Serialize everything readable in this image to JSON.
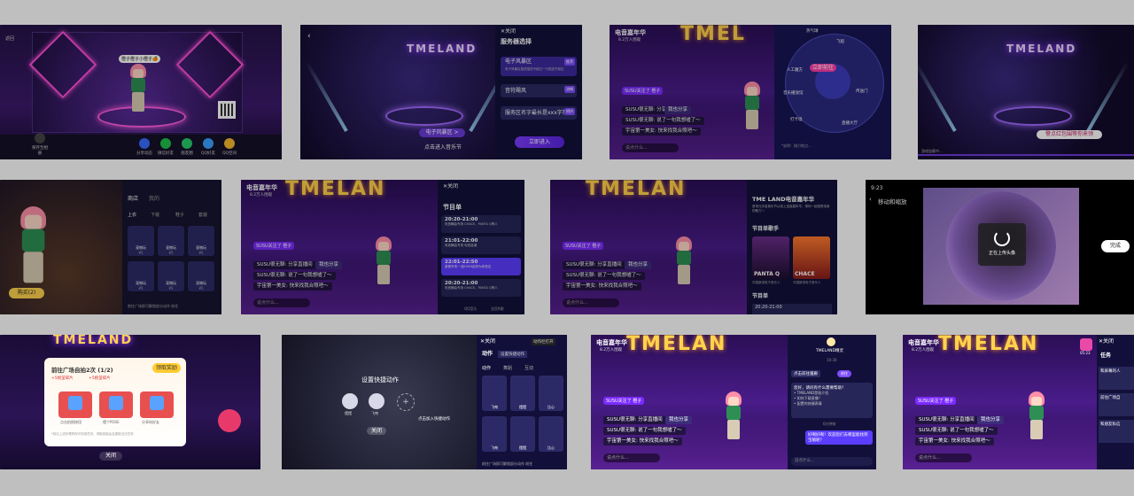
{
  "screen1": {
    "back": "返回",
    "nameplate": "橙子橙子小橙子🍊",
    "save": "保存至相册",
    "share": [
      "分享动态",
      "微信好友",
      "朋友圈",
      "QQ好友",
      "QQ空间"
    ],
    "share_colors": [
      "#3a6bff",
      "#1fbf4c",
      "#2ac96b",
      "#3aa0ff",
      "#f5b82e"
    ]
  },
  "screen2": {
    "logo": "TMELAND",
    "banner": "电子风暴区 >",
    "enter_text": "点击进入音乐节",
    "close": "✕关闭",
    "title": "服务器选择",
    "options": [
      {
        "name": "电子风暴区",
        "sub": "电子风暴区描述描述不超过一行描述不超过",
        "tag": "推荐"
      },
      {
        "name": "音符飓风",
        "sub": "",
        "tag": "流畅"
      },
      {
        "name": "服务区名字最长是xxx字符",
        "sub": "",
        "tag": "拥挤"
      }
    ],
    "enter_btn": "立即进入"
  },
  "screen3": {
    "event": "电音嘉年华",
    "viewers": "8.2万人围观",
    "mention": "SUSU关注了 橙子",
    "chat": [
      "SUSU很无聊: 分享直播间",
      "SUSU很无聊: 说了一句我想嘘了～",
      "宇宙第一美女: 快来找我合照吧～"
    ],
    "share_chip": "我也分享",
    "input": "说点什么...",
    "wheel_items": [
      "热气球",
      "飞船",
      "人工魔方",
      "立即前往",
      "音乐播放馆",
      "传送门",
      "游乐场",
      "直播大厅",
      "打卡墙",
      "现在..."
    ],
    "wheel_center": "立即前往",
    "footnote": "*说明：指引地点..."
  },
  "screen4": {
    "logo": "TMELAND",
    "hint": "警点红包围等你来领",
    "bottom": "游戏加载中..."
  },
  "screen5": {
    "tabs": [
      "商店",
      "我的"
    ],
    "cats": [
      "上衣",
      "下装",
      "鞋子",
      "套装"
    ],
    "items": [
      {
        "name": "宠物玩",
        "price": "¥5"
      },
      {
        "name": "宠物玩",
        "price": "¥5"
      },
      {
        "name": "宠物玩",
        "price": "¥5"
      },
      {
        "name": "宠物玩",
        "price": "¥5"
      },
      {
        "name": "宠物玩",
        "price": "¥5"
      },
      {
        "name": "宠物玩",
        "price": "¥5"
      }
    ],
    "buy": "购买(2)",
    "footer": "前往广场即可解锁部分动作  前往"
  },
  "screen6": {
    "event": "电音嘉年华",
    "viewers": "8.2万人围观",
    "close": "✕关闭",
    "title": "节目单",
    "items": [
      {
        "time": "20:20-21:00",
        "desc": "电音舞曲专场 CHACE、PANTA Q等人"
      },
      {
        "time": "21:01-22:00",
        "desc": "电音舞曲专场 电音高潮"
      },
      {
        "time": "22:01-22:50",
        "desc": "激情专场·一起HIGH起来为你放这"
      },
      {
        "time": "20:20-21:00",
        "desc": "电音舞曲专场 CHACE、PANTA Q等人"
      }
    ],
    "footer": [
      "QQ音乐",
      "全民K歌"
    ],
    "mention": "SUSU关注了 橙子",
    "chat": [
      "SUSU很无聊: 分享直播间",
      "SUSU很无聊: 说了一句我想嘘了～",
      "宇宙第一美女: 快来找我合照吧～"
    ],
    "share_chip": "我也分享",
    "input": "说点什么..."
  },
  "screen7": {
    "title": "TME LAND电音嘉年华",
    "desc": "首场元宇宙音乐节从线上连接嘉年华，带你一起感受电音的魅力～",
    "lineup": "节目单歌手",
    "artists": [
      "PANTA Q",
      "CHACE"
    ],
    "artist_notes": [
      "中国新锐电子音乐人",
      "中国新锐电子音乐人"
    ],
    "schedule_title": "节目单",
    "schedule_time": "20:20-21:00",
    "mention": "SUSU关注了 橙子",
    "chat": [
      "SUSU很无聊: 分享直播间",
      "SUSU很无聊: 说了一句我想嘘了～",
      "宇宙第一美女: 快来找我合照吧～"
    ],
    "share_chip": "我也分享",
    "input": "说点什么..."
  },
  "screen8": {
    "time": "9:23",
    "title": "移动和缩放",
    "loading": "正在上传头像",
    "done": "完成"
  },
  "screen9": {
    "title": "前往广场自拍2次 (1/2)",
    "claim": "领取奖励",
    "rewards": [
      "+5桃萤碎片",
      "+5桃萤碎片"
    ],
    "steps": [
      "点击拍照按钮",
      "摆个POSE",
      "分享给好友"
    ],
    "note": "*前往上述步骤同伴可完成任务，领取奖励后会更新当日任务",
    "close": "关闭"
  },
  "screen10": {
    "title": "设置快捷动作",
    "slots": [
      "摆摆",
      "飞吻"
    ],
    "hint": "点击加入快捷动作",
    "close": "关闭",
    "close2": "✕关闭",
    "toggle": "动作栏打开",
    "tabs": [
      "动作",
      "舞蹈",
      "互动"
    ],
    "set_btn": "设置快捷动作",
    "cells": [
      "飞吻",
      "摆摆",
      "比心",
      "飞吻",
      "摆摆",
      "比心"
    ],
    "footer": "前往广场即可解锁部分动作  前往"
  },
  "screen11": {
    "event": "电音嘉年华",
    "viewers": "8.2万人围观",
    "mention": "SUSU关注了 橙子",
    "chat": [
      "SUSU很无聊: 分享直播间",
      "SUSU很无聊: 说了一句我想嘘了～",
      "宇宙第一美女: 快来找我合照吧～"
    ],
    "share_chip": "我也分享",
    "input": "说点什么...",
    "bot_name": "TMELAND精灵",
    "time": "10:30",
    "go_label": "点击前往遛廊",
    "go_btn": "前往",
    "q": "您好，请问有什么需要帮助？",
    "faq": [
      "• TMELAND是啥介绍",
      "• 如何下载直播？",
      "• 配置的快捷表情"
    ],
    "faq_time": "6分钟前",
    "reply": "好啊好啊！欢迎您们去哪里能找到宝箱呢？",
    "input2": "说点什么..."
  },
  "screen12": {
    "event": "电音嘉年华",
    "viewers": "8.2万人围观",
    "badge": "05:23",
    "mention": "SUSU关注了 橙子",
    "chat": [
      "SUSU很无聊: 分享直播间",
      "SUSU很无聊: 说了一句我想嘘了～",
      "宇宙第一美女: 快来找我合照吧～"
    ],
    "share_chip": "我也分享",
    "input": "说点什么...",
    "close": "✕关闭",
    "task_title": "任务",
    "tasks": [
      "和屏幕的人",
      "前往广场自",
      "和朋友私信"
    ]
  }
}
